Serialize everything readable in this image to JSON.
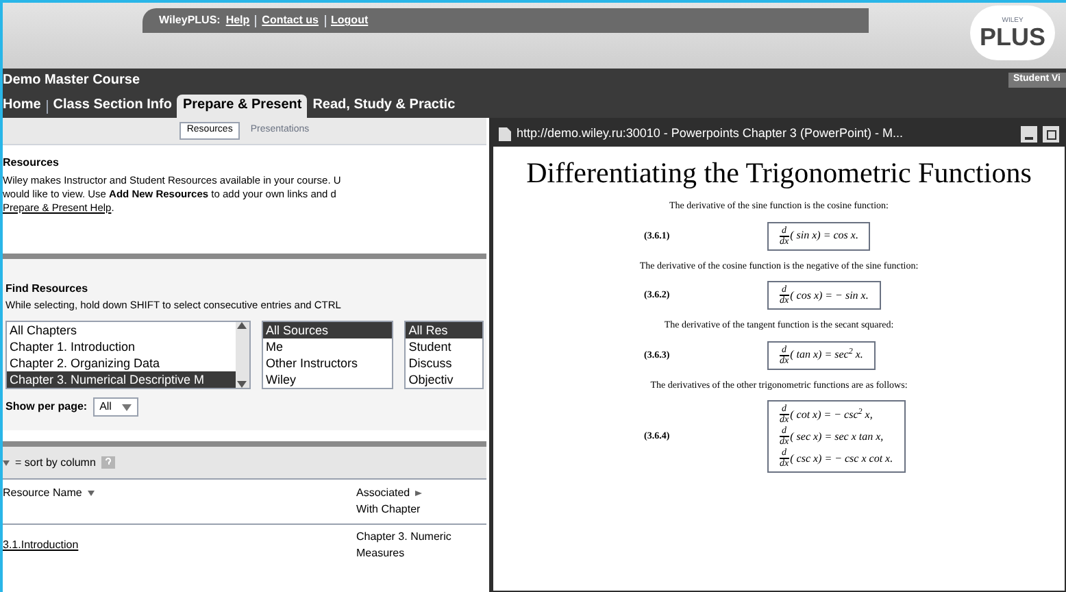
{
  "header": {
    "links_label": "WileyPLUS:",
    "links": [
      "Help",
      "Contact us",
      "Logout"
    ],
    "logo_small": "WILEY",
    "logo": "PLUS"
  },
  "course": {
    "title": "Demo Master Course",
    "view_badge": "Student Vi"
  },
  "nav": [
    {
      "label": "Home",
      "selected": false
    },
    {
      "label": "Class Section Info",
      "selected": false
    },
    {
      "label": "Prepare & Present",
      "selected": true
    },
    {
      "label": "Read, Study & Practic",
      "selected": false
    }
  ],
  "subtabs": [
    {
      "label": "Resources",
      "selected": true
    },
    {
      "label": "Presentations",
      "selected": false
    }
  ],
  "resources": {
    "heading": "Resources",
    "lines": [
      "Wiley makes Instructor and Student Resources available in your course. U",
      "would like to view. Use **Add New Resources** to add your own links and d"
    ],
    "help_link": "Prepare & Present Help",
    "help_tail": "."
  },
  "find": {
    "heading": "Find Resources",
    "hint": "While selecting, hold down SHIFT to select consecutive entries and CTRL",
    "lists": [
      {
        "scrollbar": true,
        "options": [
          {
            "label": "All Chapters",
            "selected": false
          },
          {
            "label": "Chapter 1. Introduction",
            "selected": false
          },
          {
            "label": "Chapter 2. Organizing Data",
            "selected": false
          },
          {
            "label": "Chapter 3. Numerical Descriptive M",
            "selected": true
          }
        ]
      },
      {
        "scrollbar": false,
        "options": [
          {
            "label": "All Sources",
            "selected": true
          },
          {
            "label": "Me",
            "selected": false
          },
          {
            "label": "Other Instructors",
            "selected": false
          },
          {
            "label": "Wiley",
            "selected": false
          }
        ]
      },
      {
        "scrollbar": false,
        "options": [
          {
            "label": "All Res",
            "selected": true
          },
          {
            "label": "Student",
            "selected": false
          },
          {
            "label": "Discuss",
            "selected": false
          },
          {
            "label": "Objectiv",
            "selected": false
          }
        ]
      }
    ],
    "per_page_label": "Show per page:",
    "per_page_value": "All"
  },
  "sort_hint": "= sort by column",
  "table": {
    "columns": [
      {
        "lines": [
          "Resource Name"
        ]
      },
      {
        "lines": [
          "Associated",
          "With Chapter"
        ]
      }
    ],
    "rows": [
      {
        "name": "3.1.Introduction",
        "chapter": [
          "Chapter 3. Numeric",
          "Measures"
        ]
      }
    ]
  },
  "popup": {
    "title": "http://demo.wiley.ru:30010 - Powerpoints Chapter 3  (PowerPoint) - M...",
    "slide_title": "Differentiating the Trigonometric Functions",
    "blocks": [
      {
        "kind": "text",
        "text": "The derivative of the sine function is the cosine function:"
      },
      {
        "kind": "equation",
        "number": "(3.6.1)",
        "lines": [
          {
            "numerator": "d",
            "denominator": "dx",
            "expression": "( sin x) = cos x."
          }
        ]
      },
      {
        "kind": "text",
        "text": "The derivative of the cosine function is the negative of the sine function:"
      },
      {
        "kind": "equation",
        "number": "(3.6.2)",
        "lines": [
          {
            "numerator": "d",
            "denominator": "dx",
            "expression": "( cos x) = − sin x."
          }
        ]
      },
      {
        "kind": "text",
        "text": "The derivative of the tangent function is the secant squared:"
      },
      {
        "kind": "equation",
        "number": "(3.6.3)",
        "lines": [
          {
            "numerator": "d",
            "denominator": "dx",
            "expression": "( tan x) = sec$^{2}$ x."
          }
        ]
      },
      {
        "kind": "text",
        "text": "The derivatives of the other trigonometric functions are as follows:"
      },
      {
        "kind": "equation",
        "number": "(3.6.4)",
        "lines": [
          {
            "numerator": "d",
            "denominator": "dx",
            "expression": "( cot x) = − csc$^{2}$ x,"
          },
          {
            "numerator": "d",
            "denominator": "dx",
            "expression": "( sec x) = sec x tan x,"
          },
          {
            "numerator": "d",
            "denominator": "dx",
            "expression": "( csc x) = − csc x cot x."
          }
        ]
      }
    ]
  }
}
